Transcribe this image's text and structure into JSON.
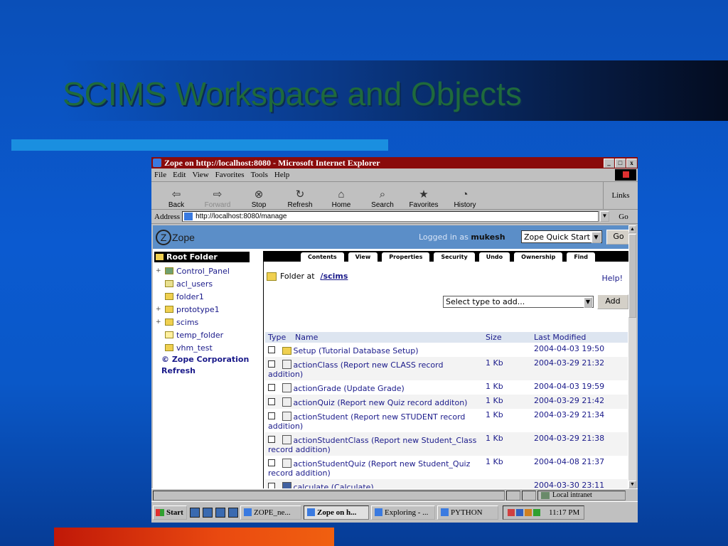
{
  "slide": {
    "title": "SCIMS Workspace and Objects"
  },
  "window": {
    "title": "Zope on http://localhost:8080 - Microsoft Internet Explorer",
    "controls": [
      "_",
      "□",
      "x"
    ]
  },
  "menu": [
    "File",
    "Edit",
    "View",
    "Favorites",
    "Tools",
    "Help"
  ],
  "toolbar": {
    "buttons": [
      {
        "label": "Back",
        "icon": "back-arrow-icon",
        "glyph": "⇦"
      },
      {
        "label": "Forward",
        "icon": "forward-arrow-icon",
        "glyph": "⇨"
      },
      {
        "label": "Stop",
        "icon": "stop-icon",
        "glyph": "⊗"
      },
      {
        "label": "Refresh",
        "icon": "refresh-icon",
        "glyph": "↻"
      },
      {
        "label": "Home",
        "icon": "home-icon",
        "glyph": "⌂"
      },
      {
        "label": "Search",
        "icon": "search-icon",
        "glyph": "⌕"
      },
      {
        "label": "Favorites",
        "icon": "favorites-icon",
        "glyph": "★"
      },
      {
        "label": "History",
        "icon": "history-icon",
        "glyph": "◔"
      }
    ],
    "links_label": "Links"
  },
  "address": {
    "label": "Address",
    "value": "http://localhost:8080/manage",
    "go_label": "Go"
  },
  "zope": {
    "logo_text": "Zope",
    "logged_in_prefix": "Logged in as",
    "user": "mukesh",
    "quick_start": "Zope Quick Start",
    "go_label": "Go"
  },
  "tree": {
    "root": "Root Folder",
    "items": [
      {
        "label": "Control_Panel",
        "expander": "+"
      },
      {
        "label": "acl_users",
        "expander": ""
      },
      {
        "label": "folder1",
        "expander": ""
      },
      {
        "label": "prototype1",
        "expander": "+"
      },
      {
        "label": "scims",
        "expander": "+"
      },
      {
        "label": "temp_folder",
        "expander": ""
      },
      {
        "label": "vhm_test",
        "expander": ""
      }
    ],
    "corp_link": "© Zope Corporation",
    "refresh": "Refresh"
  },
  "tabs": [
    "Contents",
    "View",
    "Properties",
    "Security",
    "Undo",
    "Ownership",
    "Find"
  ],
  "folder": {
    "prefix": "Folder at",
    "path": "/scims",
    "help": "Help!",
    "type_select": "Select type to add...",
    "add_label": "Add"
  },
  "table": {
    "headers": {
      "type": "Type",
      "name": "Name",
      "size": "Size",
      "modified": "Last Modified"
    },
    "rows": [
      {
        "name": "Setup (Tutorial Database Setup)",
        "size": "",
        "modified": "2004-04-03 19:50",
        "kind": "folder"
      },
      {
        "name": "actionClass (Report new CLASS record addition)",
        "size": "1 Kb",
        "modified": "2004-03-29 21:32",
        "kind": "script"
      },
      {
        "name": "actionGrade (Update Grade)",
        "size": "1 Kb",
        "modified": "2004-04-03 19:59",
        "kind": "script"
      },
      {
        "name": "actionQuiz (Report new Quiz record additon)",
        "size": "1 Kb",
        "modified": "2004-03-29 21:42",
        "kind": "script"
      },
      {
        "name": "actionStudent (Report new STUDENT record addition)",
        "size": "1 Kb",
        "modified": "2004-03-29 21:34",
        "kind": "script"
      },
      {
        "name": "actionStudentClass (Report new Student_Class record addition)",
        "size": "1 Kb",
        "modified": "2004-03-29 21:38",
        "kind": "script"
      },
      {
        "name": "actionStudentQuiz (Report new Student_Quiz record addition)",
        "size": "1 Kb",
        "modified": "2004-04-08 21:37",
        "kind": "script"
      },
      {
        "name": "calculate (Calculate)",
        "size": "",
        "modified": "2004-03-30 23:11",
        "kind": "calc"
      }
    ]
  },
  "status": {
    "zone": "Local intranet"
  },
  "taskbar": {
    "start": "Start",
    "tasks": [
      {
        "label": "ZOPE_ne...",
        "active": false
      },
      {
        "label": "Zope on h...",
        "active": true
      },
      {
        "label": "Exploring - ...",
        "active": false
      },
      {
        "label": "PYTHON",
        "active": false
      }
    ],
    "clock": "11:17 PM"
  },
  "colors": {
    "slide_bg": "#0a58c8",
    "title_text": "#1f6a3c",
    "ie_titlebar": "#8a0b0b",
    "zope_header": "#5b8ec8",
    "link": "#1a1a8a"
  }
}
